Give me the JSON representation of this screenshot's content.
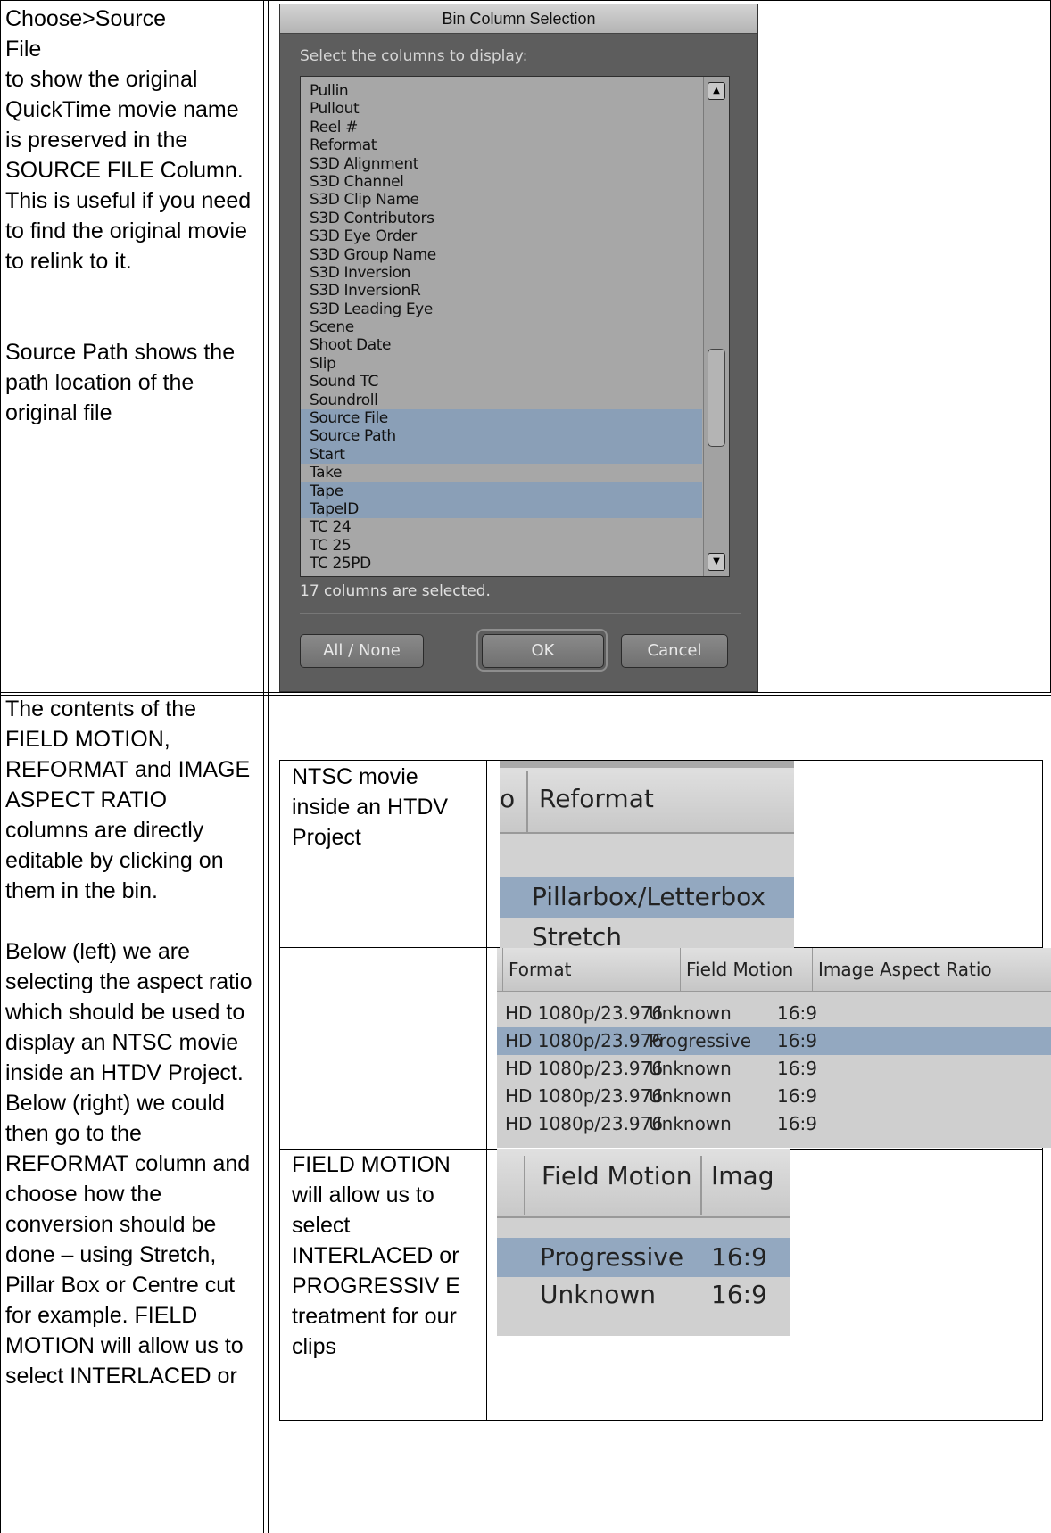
{
  "left_top": {
    "line1": "Choose>Source",
    "line2": "File",
    "para1": "to show the original QuickTime movie name is preserved in the SOURCE FILE Column. This is useful if you need to find the original movie to relink to it.",
    "para2": "Source Path shows the path location of the original file"
  },
  "left_bottom": {
    "para1": "The contents of the FIELD MOTION, REFORMAT and IMAGE ASPECT RATIO columns are directly editable by clicking on them in the bin.",
    "para2": "Below (left) we are selecting the aspect ratio which should be used to display an NTSC movie inside an HTDV Project. Below (right) we could then go to the REFORMAT column and choose how the conversion should be done – using Stretch, Pillar Box or Centre cut for example. FIELD MOTION will allow us to select INTERLACED or"
  },
  "dialog": {
    "title": "Bin Column Selection",
    "prompt": "Select the columns to display:",
    "columns": [
      {
        "label": "Pullin",
        "selected": false
      },
      {
        "label": "Pullout",
        "selected": false
      },
      {
        "label": "Reel #",
        "selected": false
      },
      {
        "label": "Reformat",
        "selected": false
      },
      {
        "label": "S3D Alignment",
        "selected": false
      },
      {
        "label": "S3D Channel",
        "selected": false
      },
      {
        "label": "S3D Clip Name",
        "selected": false
      },
      {
        "label": "S3D Contributors",
        "selected": false
      },
      {
        "label": "S3D Eye Order",
        "selected": false
      },
      {
        "label": "S3D Group Name",
        "selected": false
      },
      {
        "label": "S3D Inversion",
        "selected": false
      },
      {
        "label": "S3D InversionR",
        "selected": false
      },
      {
        "label": "S3D Leading Eye",
        "selected": false
      },
      {
        "label": "Scene",
        "selected": false
      },
      {
        "label": "Shoot Date",
        "selected": false
      },
      {
        "label": "Slip",
        "selected": false
      },
      {
        "label": "Sound TC",
        "selected": false
      },
      {
        "label": "Soundroll",
        "selected": false
      },
      {
        "label": "Source File",
        "selected": true
      },
      {
        "label": "Source Path",
        "selected": true
      },
      {
        "label": "Start",
        "selected": true
      },
      {
        "label": "Take",
        "selected": false
      },
      {
        "label": "Tape",
        "selected": true
      },
      {
        "label": "TapeID",
        "selected": true
      },
      {
        "label": "TC 24",
        "selected": false
      },
      {
        "label": "TC 25",
        "selected": false
      },
      {
        "label": "TC 25PD",
        "selected": false
      }
    ],
    "status": "17 columns are selected.",
    "buttons": {
      "all_none": "All / None",
      "ok": "OK",
      "cancel": "Cancel"
    },
    "scroll_up_glyph": "▲",
    "scroll_down_glyph": "▼"
  },
  "inner_table": {
    "ntsc_note": "NTSC movie inside an HTDV Project",
    "field_note": "FIELD MOTION will allow us to select INTERLACED or PROGRESSIV E treatment for our clips"
  },
  "reformat_shot": {
    "header_partial": "o",
    "header": "Reformat",
    "options": [
      "Pillarbox/Letterbox",
      "Stretch"
    ]
  },
  "format_shot": {
    "headers": [
      "Format",
      "Field Motion",
      "Image Aspect Ratio"
    ],
    "rows": [
      {
        "format": "HD 1080p/23.976",
        "field_motion": "Unknown",
        "aspect": "16:9",
        "selected": false
      },
      {
        "format": "HD 1080p/23.976",
        "field_motion": "Progressive",
        "aspect": "16:9",
        "selected": true
      },
      {
        "format": "HD 1080p/23.976",
        "field_motion": "Unknown",
        "aspect": "16:9",
        "selected": false
      },
      {
        "format": "HD 1080p/23.976",
        "field_motion": "Unknown",
        "aspect": "16:9",
        "selected": false
      },
      {
        "format": "HD 1080p/23.976",
        "field_motion": "Unknown",
        "aspect": "16:9",
        "selected": false
      }
    ]
  },
  "field_shot": {
    "headers": [
      "Field Motion",
      "Imag"
    ],
    "rows": [
      {
        "field_motion": "Progressive",
        "aspect": "16:9",
        "selected": true
      },
      {
        "field_motion": "Unknown",
        "aspect": "16:9",
        "selected": false
      }
    ]
  },
  "colors": {
    "selection": "#8a9fb7",
    "dialog_bg": "#5d5d5d",
    "list_bg": "#a7a7a7"
  }
}
